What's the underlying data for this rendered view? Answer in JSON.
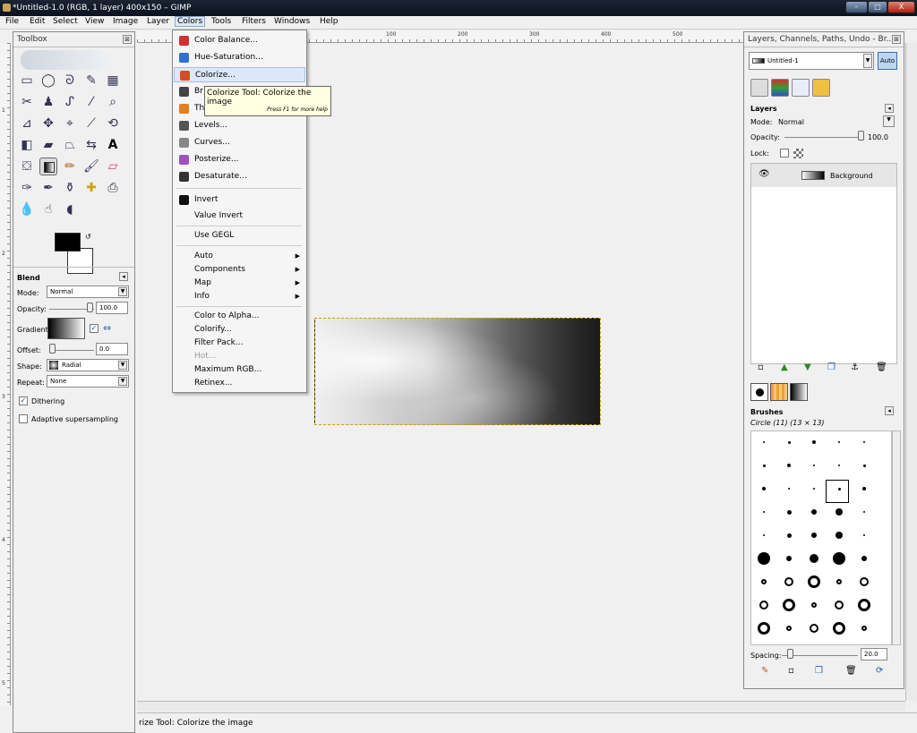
{
  "window": {
    "title": "*Untitled-1.0 (RGB, 1 layer) 400x150 – GIMP",
    "btn_min": "–",
    "btn_max": "□",
    "btn_close": "X"
  },
  "menubar": [
    "File",
    "Edit",
    "Select",
    "View",
    "Image",
    "Layer",
    "Colors",
    "Tools",
    "Filters",
    "Windows",
    "Help"
  ],
  "ruler": {
    "x_ticks": [
      "100",
      "200",
      "300",
      "400",
      "500"
    ],
    "y_ticks": [
      "1",
      "2",
      "3",
      "4",
      "5"
    ]
  },
  "toolbox": {
    "title": "Toolbox",
    "close": "⊠",
    "options_title": "Blend",
    "options_btn": "◂",
    "mode_label": "Mode:",
    "mode_value": "Normal",
    "opacity_label": "Opacity:",
    "opacity_value": "100.0",
    "gradient_label": "Gradient:",
    "offset_label": "Offset:",
    "offset_value": "0.0",
    "shape_label": "Shape:",
    "shape_value": "Radial",
    "repeat_label": "Repeat:",
    "repeat_value": "None",
    "dithering_label": "Dithering",
    "dithering_checked": true,
    "adaptive_label": "Adaptive supersampling",
    "adaptive_checked": false
  },
  "colors_menu": [
    {
      "label": "Color Balance...",
      "icon": "color-balance-icon",
      "color": "#d03030"
    },
    {
      "label": "Hue-Saturation...",
      "icon": "hue-saturation-icon",
      "color": "#3070d0"
    },
    {
      "label": "Colorize...",
      "icon": "colorize-icon",
      "color": "#d05020",
      "highlight": true
    },
    {
      "label": "Br",
      "icon": "brightness-icon",
      "color": "#444"
    },
    {
      "label": "Th",
      "icon": "threshold-icon",
      "color": "#e08020"
    },
    {
      "label": "Levels...",
      "icon": "levels-icon",
      "color": "#555"
    },
    {
      "label": "Curves...",
      "icon": "curves-icon",
      "color": "#888"
    },
    {
      "label": "Posterize...",
      "icon": "posterize-icon",
      "color": "#a050c0"
    },
    {
      "label": "Desaturate...",
      "icon": "desaturate-icon",
      "color": "#333"
    }
  ],
  "colors_menu2": [
    {
      "label": "Invert",
      "icon": "invert-icon"
    },
    {
      "label": "Value Invert"
    },
    {
      "label": "Use GEGL"
    },
    {
      "label": "Auto",
      "sub": "▶"
    },
    {
      "label": "Components",
      "sub": "▶"
    },
    {
      "label": "Map",
      "sub": "▶"
    },
    {
      "label": "Info",
      "sub": "▶"
    },
    {
      "label": "Color to Alpha..."
    },
    {
      "label": "Colorify..."
    },
    {
      "label": "Filter Pack..."
    },
    {
      "label": "Hot...",
      "disabled": true
    },
    {
      "label": "Maximum RGB..."
    },
    {
      "label": "Retinex..."
    }
  ],
  "tooltip": {
    "text": "Colorize Tool: Colorize the image",
    "hint": "Press F1 for more help"
  },
  "dock": {
    "title": "Layers, Channels, Paths, Undo - Br...",
    "close": "⊠",
    "image_select": "Untitled-1",
    "auto": "Auto",
    "layers_title": "Layers",
    "layers_btn": "◂",
    "mode_label": "Mode:",
    "mode_value": "Normal",
    "opacity_label": "Opacity:",
    "opacity_value": "100.0",
    "lock_label": "Lock:",
    "layer_name": "Background",
    "brushes_title": "Brushes",
    "brushes_btn": "◂",
    "brush_name": "Circle (11) (13 × 13)",
    "spacing_label": "Spacing:",
    "spacing_value": "20.0"
  },
  "status": {
    "text": "rize Tool: Colorize the image"
  }
}
